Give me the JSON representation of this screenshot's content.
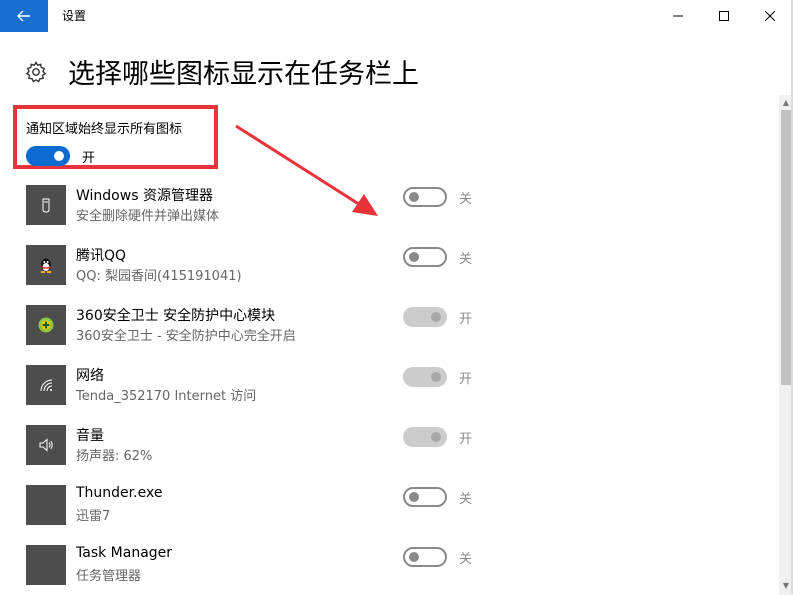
{
  "window": {
    "title": "设置"
  },
  "header": {
    "title": "选择哪些图标显示在任务栏上"
  },
  "always_show": {
    "label": "通知区域始终显示所有图标",
    "state": "开",
    "on": true
  },
  "rows": [
    {
      "name": "Windows 资源管理器",
      "sub": "安全删除硬件并弹出媒体",
      "state": "关",
      "on": false,
      "disabled": false,
      "icon": "usb-icon"
    },
    {
      "name": "腾讯QQ",
      "sub": "QQ: 梨园香间(415191041)",
      "state": "关",
      "on": false,
      "disabled": false,
      "icon": "qq-penguin-icon"
    },
    {
      "name": "360安全卫士 安全防护中心模块",
      "sub": "360安全卫士 - 安全防护中心完全开启",
      "state": "开",
      "on": true,
      "disabled": true,
      "icon": "shield-360-icon"
    },
    {
      "name": "网络",
      "sub": "Tenda_352170 Internet 访问",
      "state": "开",
      "on": true,
      "disabled": true,
      "icon": "wifi-icon"
    },
    {
      "name": "音量",
      "sub": "扬声器: 62%",
      "state": "开",
      "on": true,
      "disabled": true,
      "icon": "speaker-icon"
    },
    {
      "name": "Thunder.exe",
      "sub": "迅雷7",
      "state": "关",
      "on": false,
      "disabled": false,
      "icon": "blank-icon"
    },
    {
      "name": "Task Manager",
      "sub": "任务管理器",
      "state": "关",
      "on": false,
      "disabled": false,
      "icon": "blank-icon"
    }
  ],
  "colors": {
    "accent": "#0b6bd0",
    "highlight": "#e8333a",
    "tile": "#4d4d4d"
  }
}
